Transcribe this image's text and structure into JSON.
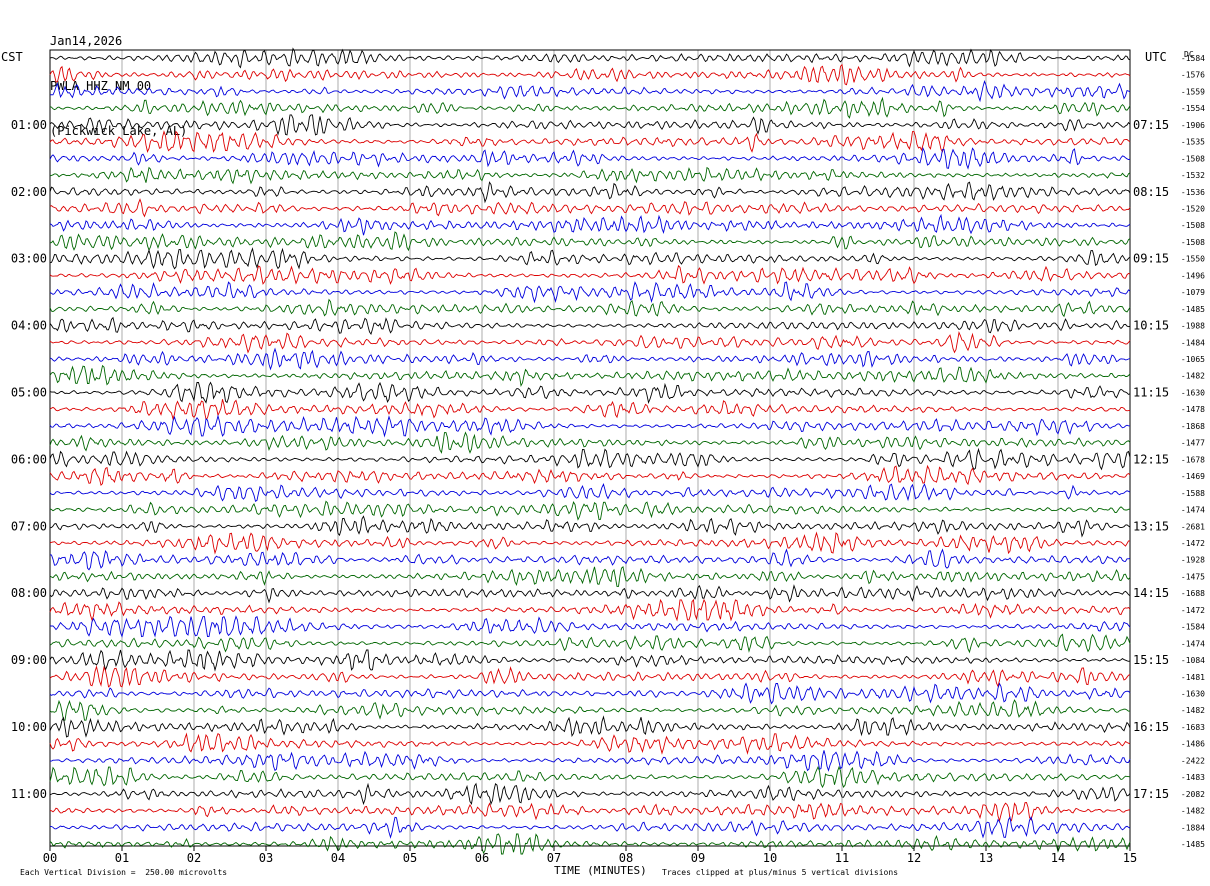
{
  "header": {
    "date": "Jan14,2026",
    "station": "PWLA HHZ NM 00",
    "location": "(Pickwick Lake, AL)"
  },
  "corners": {
    "left_timezone": "CST",
    "right_timezone": "UTC",
    "dc_label": "DC"
  },
  "footer": {
    "scale_note": "Each Vertical Division =  250.00 microvolts",
    "xlabel": "TIME (MINUTES)",
    "clip_note": "Traces clipped at plus/minus 5 vertical divisions"
  },
  "colors": {
    "trace_cycle": [
      "#000000",
      "#dd0000",
      "#0000dd",
      "#006600"
    ],
    "grid": "#000000",
    "background": "#ffffff"
  },
  "chart_data": {
    "type": "line",
    "title": "PWLA HHZ NM 00",
    "xlabel": "TIME (MINUTES)",
    "xlim": [
      0,
      15
    ],
    "x_ticks": [
      "00",
      "01",
      "02",
      "03",
      "04",
      "05",
      "06",
      "07",
      "08",
      "09",
      "10",
      "11",
      "12",
      "13",
      "14",
      "15"
    ],
    "trace_minutes": 15,
    "trace_count": 48,
    "left_time_labels": [
      {
        "trace": 4,
        "label": "01:00"
      },
      {
        "trace": 8,
        "label": "02:00"
      },
      {
        "trace": 12,
        "label": "03:00"
      },
      {
        "trace": 16,
        "label": "04:00"
      },
      {
        "trace": 20,
        "label": "05:00"
      },
      {
        "trace": 24,
        "label": "06:00"
      },
      {
        "trace": 28,
        "label": "07:00"
      },
      {
        "trace": 32,
        "label": "08:00"
      },
      {
        "trace": 36,
        "label": "09:00"
      },
      {
        "trace": 40,
        "label": "10:00"
      },
      {
        "trace": 44,
        "label": "11:00"
      }
    ],
    "right_time_labels": [
      {
        "trace": 4,
        "label": "07:15"
      },
      {
        "trace": 8,
        "label": "08:15"
      },
      {
        "trace": 12,
        "label": "09:15"
      },
      {
        "trace": 16,
        "label": "10:15"
      },
      {
        "trace": 20,
        "label": "11:15"
      },
      {
        "trace": 24,
        "label": "12:15"
      },
      {
        "trace": 28,
        "label": "13:15"
      },
      {
        "trace": 32,
        "label": "14:15"
      },
      {
        "trace": 36,
        "label": "15:15"
      },
      {
        "trace": 40,
        "label": "16:15"
      },
      {
        "trace": 44,
        "label": "17:15"
      }
    ],
    "dc_offsets": [
      "-1584",
      "-1576",
      "-1559",
      "-1554",
      "-1906",
      "-1535",
      "-1508",
      "-1532",
      "-1536",
      "-1520",
      "-1508",
      "-1508",
      "-1550",
      "-1496",
      "-1079",
      "-1485",
      "-1988",
      "-1484",
      "-1065",
      "-1482",
      "-1630",
      "-1478",
      "-1868",
      "-1477",
      "-1678",
      "-1469",
      "-1588",
      "-1474",
      "-2681",
      "-1472",
      "-1928",
      "-1475",
      "-1688",
      "-1472",
      "-1584",
      "-1474",
      "-1084",
      "-1481",
      "-1630",
      "-1482",
      "-1683",
      "-1486",
      "-2422",
      "-1483",
      "-2082",
      "-1482",
      "-1884",
      "-1485"
    ]
  }
}
